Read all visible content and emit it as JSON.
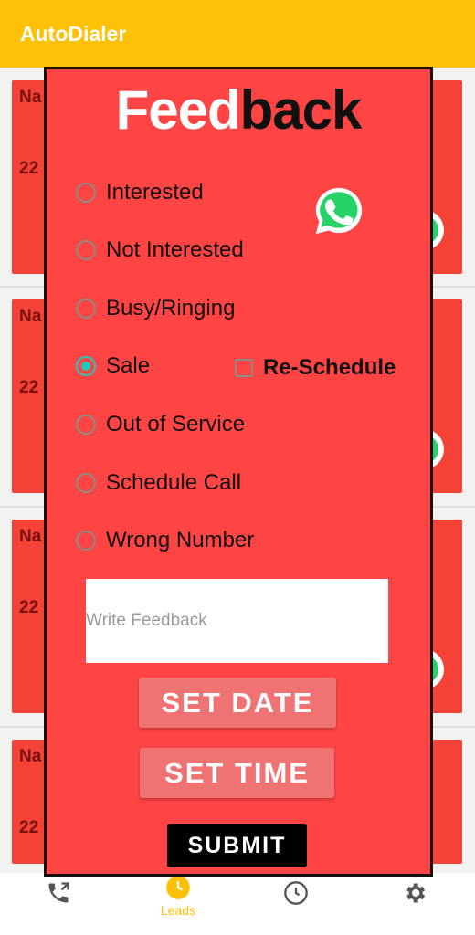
{
  "app": {
    "title": "AutoDialer"
  },
  "background_cards": [
    {
      "name_text": "Na",
      "number_text": "22"
    },
    {
      "name_text": "Na",
      "number_text": "22"
    },
    {
      "name_text": "Na",
      "number_text": "22"
    },
    {
      "name_text": "Na",
      "number_text": "22"
    }
  ],
  "dialog": {
    "heading_part1": "Feed",
    "heading_part2": "back",
    "options": [
      {
        "label": "Interested",
        "checked": false
      },
      {
        "label": "Not Interested",
        "checked": false
      },
      {
        "label": "Busy/Ringing",
        "checked": false
      },
      {
        "label": "Sale",
        "checked": true
      },
      {
        "label": "Out of Service",
        "checked": false
      },
      {
        "label": "Schedule Call",
        "checked": false
      },
      {
        "label": "Wrong Number",
        "checked": false
      }
    ],
    "reschedule": {
      "label": "Re-Schedule",
      "checked": false
    },
    "feedback_input": {
      "value": "",
      "placeholder": "Write Feedback"
    },
    "set_date_label": "SET DATE",
    "set_time_label": "SET TIME",
    "submit_label": "SUBMIT",
    "icon": "whatsapp-icon"
  },
  "bottom_nav": {
    "items": [
      {
        "icon": "phone-call-icon",
        "label": ""
      },
      {
        "icon": "clock-icon",
        "label": "Leads",
        "active": true
      },
      {
        "icon": "history-icon",
        "label": ""
      },
      {
        "icon": "gear-icon",
        "label": ""
      }
    ]
  },
  "colors": {
    "appbar": "#FFC107",
    "dialog_bg": "#FF4444",
    "card_bg": "#F44336",
    "accent_radio": "#1EC7C0",
    "whatsapp": "#25D366",
    "button_light": "#F07373"
  }
}
